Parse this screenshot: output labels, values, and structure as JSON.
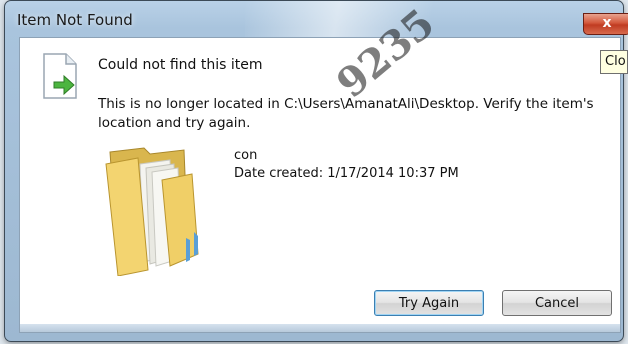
{
  "window": {
    "title": "Item Not Found",
    "close_label": "x"
  },
  "message": {
    "heading": "Could not find this item",
    "body": "This is no longer located in C:\\Users\\AmanatAli\\Desktop. Verify the item's location and try again."
  },
  "item": {
    "name": "con",
    "date_created": "Date created: 1/17/2014 10:37 PM"
  },
  "buttons": {
    "try_again": "Try Again",
    "cancel": "Cancel"
  },
  "tooltip": {
    "text": "Clo"
  },
  "watermark": {
    "text": "9235"
  },
  "icons": {
    "file": "file-restore-icon",
    "folder": "folder-icon"
  }
}
